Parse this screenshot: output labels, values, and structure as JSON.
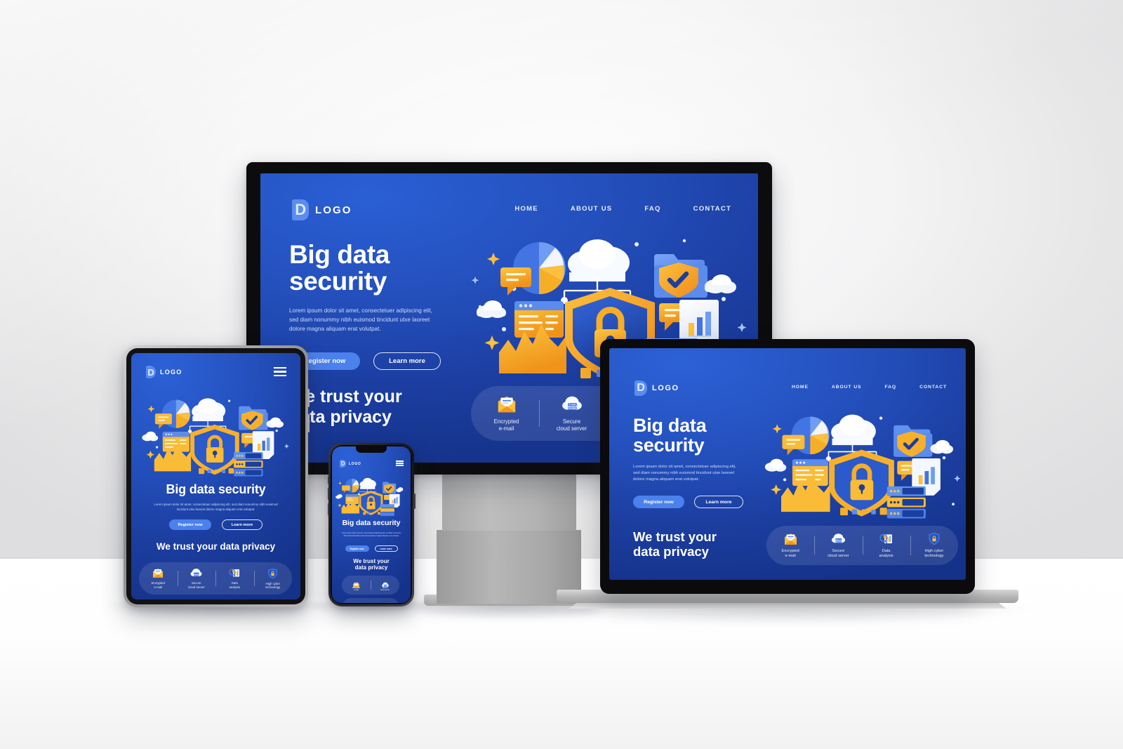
{
  "site": {
    "logo_letter": "D",
    "logo_text": "LOGO",
    "nav": [
      {
        "label": "HOME"
      },
      {
        "label": "ABOUT US"
      },
      {
        "label": "FAQ"
      },
      {
        "label": "CONTACT"
      }
    ],
    "headline_line1": "Big data",
    "headline_line2": "security",
    "headline_single": "Big data security",
    "paragraph": "Lorem ipsum dolor sit amet, consectetuer adipiscing elit, sed diam nonummy nibh euismod tincidunt utxe laoreet dolore magna aliquam erat volutpat.",
    "cta_primary": "Register now",
    "cta_secondary": "Learn more",
    "trust_line1": "We trust your",
    "trust_line2": "data privacy",
    "trust_single": "We trust your data privacy",
    "features": [
      {
        "icon": "encrypted-email-icon",
        "line1": "Encrypted",
        "line2": "e-mail"
      },
      {
        "icon": "secure-cloud-server-icon",
        "line1": "Secure",
        "line2": "cloud server"
      },
      {
        "icon": "data-analysis-icon",
        "line1": "Data",
        "line2": "analysis"
      },
      {
        "icon": "high-cyber-technology-icon",
        "line1": "High cyber",
        "line2": "technology"
      }
    ]
  },
  "colors": {
    "brand_blue": "#2450bd",
    "deep_blue": "#16348d",
    "accent_blue": "#4b81ec",
    "light_blue": "#6e9df3",
    "amber": "#f7ae27",
    "amber_light": "#fcc03c",
    "amber_dark": "#f0971c",
    "white": "#ffffff",
    "bezel_black": "#0c0c0e",
    "device_silver": "#b4b4b4",
    "wall": "#e6e6e7",
    "floor": "#ffffff"
  },
  "devices": [
    {
      "name": "desktop-monitor",
      "type": "monitor"
    },
    {
      "name": "laptop",
      "type": "laptop"
    },
    {
      "name": "tablet",
      "type": "tablet"
    },
    {
      "name": "smartphone",
      "type": "phone"
    }
  ]
}
